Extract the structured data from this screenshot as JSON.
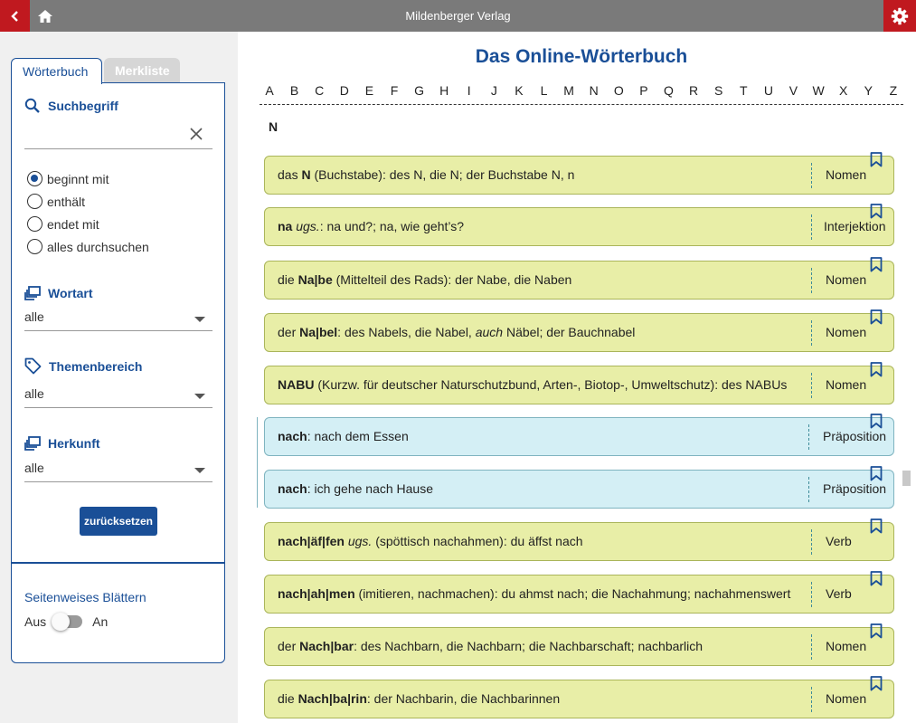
{
  "header": {
    "title": "Mildenberger Verlag",
    "back_icon": "chevron-left-icon",
    "home_icon": "home-icon",
    "settings_icon": "gear-icon",
    "accent": "#c0191f"
  },
  "sidebar": {
    "tabs": [
      {
        "label": "Wörterbuch",
        "active": true
      },
      {
        "label": "Merkliste",
        "active": false
      }
    ],
    "search": {
      "title": "Suchbegriff",
      "value": ""
    },
    "search_modes": [
      {
        "label": "beginnt mit",
        "checked": true
      },
      {
        "label": "enthält",
        "checked": false
      },
      {
        "label": "endet mit",
        "checked": false
      },
      {
        "label": "alles durchsuchen",
        "checked": false
      }
    ],
    "wortart": {
      "title": "Wortart",
      "value": "alle"
    },
    "themenbereich": {
      "title": "Themenbereich",
      "value": "alle"
    },
    "herkunft": {
      "title": "Herkunft",
      "value": "alle"
    },
    "reset_label": "zurücksetzen",
    "paging": {
      "title": "Seitenweises Blättern",
      "off_label": "Aus",
      "on_label": "An",
      "enabled": false
    }
  },
  "main": {
    "title": "Das Online-Wörterbuch",
    "alphabet": [
      "A",
      "B",
      "C",
      "D",
      "E",
      "F",
      "G",
      "H",
      "I",
      "J",
      "K",
      "L",
      "M",
      "N",
      "O",
      "P",
      "Q",
      "R",
      "S",
      "T",
      "U",
      "V",
      "W",
      "X",
      "Y",
      "Z"
    ],
    "current_letter": "N",
    "entries": [
      {
        "art": "das ",
        "word": "N",
        "rest": " (Buchstabe): des N, die N; der Buchstabe N, n",
        "pos": "Nomen",
        "color": "green"
      },
      {
        "art": "",
        "word": "na",
        "rest_italic": "ugs.",
        "rest": ": na und?; na, wie geht’s?",
        "pos": "Interjektion",
        "color": "green"
      },
      {
        "art": "die ",
        "word": "Na|be",
        "rest": " (Mittelteil des Rads): der Nabe, die Naben",
        "pos": "Nomen",
        "color": "green"
      },
      {
        "art": "der ",
        "word": "Na|bel",
        "rest": ": des Nabels, die Nabel, ",
        "rest_italic2": "auch",
        "rest2": " Näbel; der Bauchnabel",
        "pos": "Nomen",
        "color": "green"
      },
      {
        "art": "",
        "word": "NABU",
        "rest": " (Kurzw. für deutscher Naturschutzbund, Arten-, Biotop-, Umweltschutz): des NABUs",
        "pos": "Nomen",
        "color": "green"
      },
      {
        "art": "",
        "word": "nach",
        "rest": ": nach dem Essen",
        "pos": "Präposition",
        "color": "blue"
      },
      {
        "art": "",
        "word": "nach",
        "rest": ": ich gehe nach Hause",
        "pos": "Präposition",
        "color": "blue"
      },
      {
        "art": "",
        "word": "nach|äf|fen",
        "rest_italic": "ugs.",
        "rest": " (spöttisch nachahmen): du äffst nach",
        "pos": "Verb",
        "color": "green"
      },
      {
        "art": "",
        "word": "nach|ah|men",
        "rest": " (imitieren, nachmachen): du ahmst nach; die Nachahmung; nachahmenswert",
        "pos": "Verb",
        "color": "green"
      },
      {
        "art": "der ",
        "word": "Nach|bar",
        "rest": ": des Nachbarn, die Nachbarn; die Nachbarschaft; nachbarlich",
        "pos": "Nomen",
        "color": "green"
      },
      {
        "art": "die ",
        "word": "Nach|ba|rin",
        "rest": ": der Nachbarin, die Nachbarinnen",
        "pos": "Nomen",
        "color": "green"
      }
    ]
  }
}
